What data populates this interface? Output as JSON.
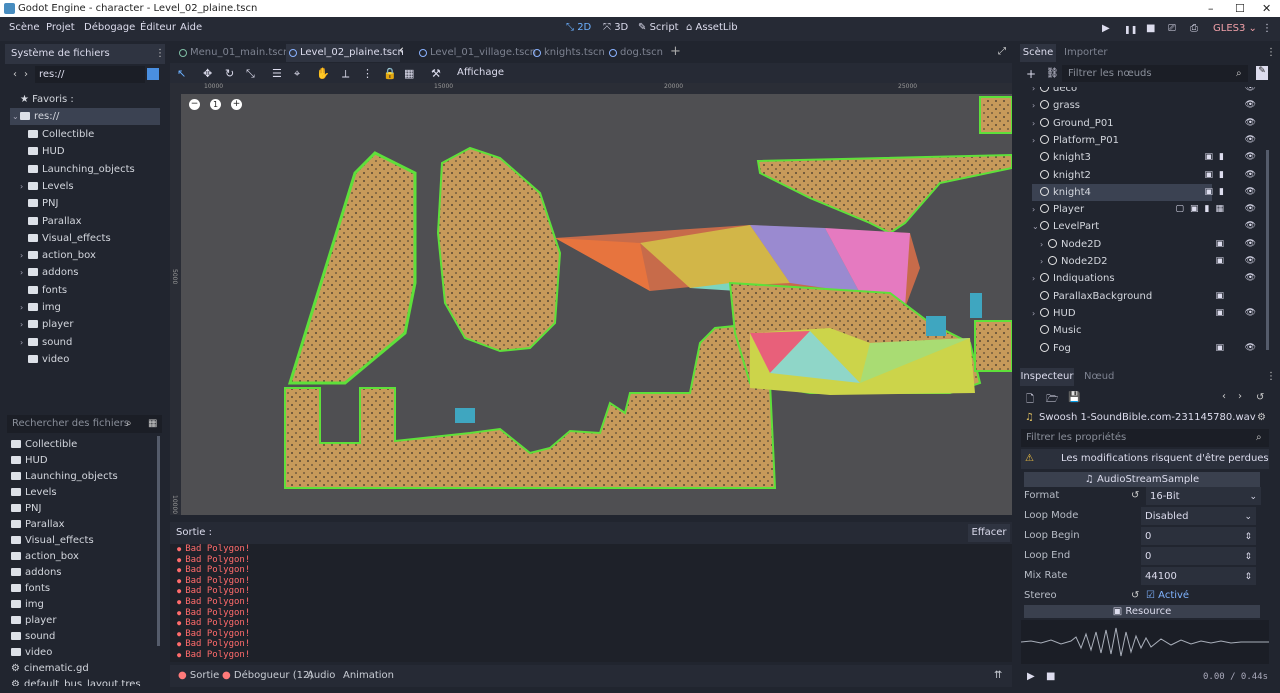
{
  "window": {
    "title": "Godot Engine - character - Level_02_plaine.tscn",
    "controls": [
      "–",
      "☐",
      "✕"
    ]
  },
  "menubar": {
    "items": [
      "Scène",
      "Projet",
      "Débogage",
      "Éditeur",
      "Aide"
    ],
    "workspaces": [
      "2D",
      "3D",
      "Script",
      "AssetLib"
    ],
    "play_icons": [
      "▶",
      "❚❚",
      "■",
      "⎚",
      "⎙"
    ],
    "renderer": "GLES3"
  },
  "filesystem": {
    "title": "Système de fichiers",
    "path": "res://",
    "favorites_label": "Favoris :",
    "root": "res://",
    "tree": [
      {
        "label": "Collectible",
        "arrow": ""
      },
      {
        "label": "HUD",
        "arrow": ""
      },
      {
        "label": "Launching_objects",
        "arrow": ""
      },
      {
        "label": "Levels",
        "arrow": "›"
      },
      {
        "label": "PNJ",
        "arrow": ""
      },
      {
        "label": "Parallax",
        "arrow": ""
      },
      {
        "label": "Visual_effects",
        "arrow": ""
      },
      {
        "label": "action_box",
        "arrow": "›"
      },
      {
        "label": "addons",
        "arrow": "›"
      },
      {
        "label": "fonts",
        "arrow": ""
      },
      {
        "label": "img",
        "arrow": "›"
      },
      {
        "label": "player",
        "arrow": "›"
      },
      {
        "label": "sound",
        "arrow": "›"
      },
      {
        "label": "video",
        "arrow": ""
      }
    ],
    "search_placeholder": "Rechercher des fichiers",
    "list": [
      "Collectible",
      "HUD",
      "Launching_objects",
      "Levels",
      "PNJ",
      "Parallax",
      "Visual_effects",
      "action_box",
      "addons",
      "fonts",
      "img",
      "player",
      "sound",
      "video",
      "cinematic.gd",
      "default_bus_layout.tres"
    ]
  },
  "tabs": [
    {
      "label": "Menu_01_main.tscn",
      "active": false,
      "dot": "green"
    },
    {
      "label": "Level_02_plaine.tscn",
      "active": true,
      "dot": "blue"
    },
    {
      "label": "Level_01_village.tscn",
      "active": false,
      "dot": "blue"
    },
    {
      "label": "knights.tscn",
      "active": false,
      "dot": "blue"
    },
    {
      "label": "dog.tscn",
      "active": false,
      "dot": "blue"
    }
  ],
  "toolbar": {
    "view_label": "Affichage"
  },
  "ruler": {
    "marks": [
      "10000",
      "15000",
      "20000",
      "25000"
    ],
    "vmarks": [
      "5000",
      "10000"
    ]
  },
  "zoom": {
    "minus": "−",
    "reset": "1",
    "plus": "+"
  },
  "output": {
    "title": "Sortie :",
    "clear_label": "Effacer",
    "lines": [
      "Bad Polygon!",
      "Bad Polygon!",
      "Bad Polygon!",
      "Bad Polygon!",
      "Bad Polygon!",
      "Bad Polygon!",
      "Bad Polygon!",
      "Bad Polygon!",
      "Bad Polygon!",
      "Bad Polygon!",
      "Bad Polygon!"
    ]
  },
  "bottom_tabs": [
    "Sortie",
    "Débogueur (12)",
    "Audio",
    "Animation"
  ],
  "scene": {
    "tab_scene": "Scène",
    "tab_import": "Importer",
    "filter_placeholder": "Filtrer les nœuds",
    "nodes": [
      {
        "label": "deco",
        "indent": 0,
        "arrow": "›",
        "icons": ""
      },
      {
        "label": "grass",
        "indent": 0,
        "arrow": "›",
        "icons": ""
      },
      {
        "label": "Ground_P01",
        "indent": 0,
        "arrow": "›",
        "icons": ""
      },
      {
        "label": "Platform_P01",
        "indent": 0,
        "arrow": "›",
        "icons": ""
      },
      {
        "label": "knight3",
        "indent": 0,
        "arrow": "",
        "icons": "▣▮"
      },
      {
        "label": "knight2",
        "indent": 0,
        "arrow": "",
        "icons": "▣▮"
      },
      {
        "label": "knight4",
        "indent": 0,
        "arrow": "",
        "icons": "▣▮",
        "selected": true
      },
      {
        "label": "Player",
        "indent": 0,
        "arrow": "›",
        "icons": "▢▣▮▦"
      },
      {
        "label": "LevelPart",
        "indent": 0,
        "arrow": "⌄",
        "icons": ""
      },
      {
        "label": "Node2D",
        "indent": 1,
        "arrow": "›",
        "icons": "▣"
      },
      {
        "label": "Node2D2",
        "indent": 1,
        "arrow": "›",
        "icons": "▣"
      },
      {
        "label": "Indiquations",
        "indent": 0,
        "arrow": "›",
        "icons": ""
      },
      {
        "label": "ParallaxBackground",
        "indent": 0,
        "arrow": "",
        "icons": "▣",
        "noeye": true
      },
      {
        "label": "HUD",
        "indent": 0,
        "arrow": "›",
        "icons": "▣"
      },
      {
        "label": "Music",
        "indent": 0,
        "arrow": "",
        "icons": "",
        "noeye": true
      },
      {
        "label": "Fog",
        "indent": 0,
        "arrow": "",
        "icons": "▣"
      }
    ]
  },
  "inspector": {
    "tab_inspector": "Inspecteur",
    "tab_node": "Nœud",
    "resource_name": "Swoosh 1-SoundBible.com-231145780.wav",
    "filter_placeholder": "Filtrer les propriétés",
    "warning": "Les modifications risquent d'être perdues !",
    "class_name": "AudioStreamSample",
    "props": [
      {
        "label": "Format",
        "value": "16-Bit",
        "control": "⌄",
        "revert": true
      },
      {
        "label": "Loop Mode",
        "value": "Disabled",
        "control": "⌄"
      },
      {
        "label": "Loop Begin",
        "value": "0",
        "control": "⇕"
      },
      {
        "label": "Loop End",
        "value": "0",
        "control": "⇕"
      },
      {
        "label": "Mix Rate",
        "value": "44100",
        "control": "⇕"
      }
    ],
    "stereo_label": "Stereo",
    "stereo_value": "Activé",
    "resource_section": "Resource",
    "time_readout": "0.00 / 0.44s"
  }
}
